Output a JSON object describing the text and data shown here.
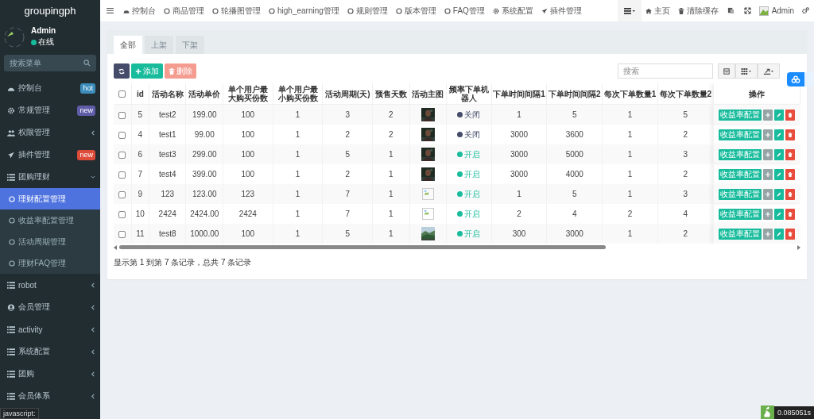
{
  "sidebar": {
    "brand": "groupingph",
    "user": {
      "name": "Admin",
      "status": "在线",
      "online": true
    },
    "search": {
      "placeholder": "搜索菜单"
    },
    "menu": [
      {
        "label": "控制台",
        "badge": {
          "text": "hot",
          "color": "#3c8dbc"
        }
      },
      {
        "label": "常规管理",
        "badge": {
          "text": "new",
          "color": "#605ca8"
        }
      },
      {
        "label": "权限管理",
        "expanded": false
      },
      {
        "label": "插件管理",
        "badge": {
          "text": "new",
          "color": "#dd4b39"
        }
      },
      {
        "label": "团购理财",
        "expanded": true,
        "children": [
          {
            "label": "理财配置管理",
            "selected": true
          },
          {
            "label": "收益率配置管理",
            "selected": false
          },
          {
            "label": "活动周期管理",
            "selected": false
          },
          {
            "label": "理财FAQ管理",
            "selected": false
          }
        ]
      },
      {
        "label": "robot",
        "expanded": false
      },
      {
        "label": "会员管理",
        "expanded": false
      },
      {
        "label": "activity",
        "expanded": false
      },
      {
        "label": "系统配置",
        "expanded": false
      },
      {
        "label": "团购",
        "expanded": false
      },
      {
        "label": "会员体系",
        "expanded": false
      }
    ]
  },
  "topnav": {
    "items": [
      "控制台",
      "商品管理",
      "轮播图管理",
      "high_earning管理",
      "规则管理",
      "版本管理",
      "FAQ管理",
      "系统配置",
      "插件管理"
    ],
    "tools": [
      "主页",
      "清除缓存"
    ],
    "user": "Admin"
  },
  "tabs": [
    {
      "label": "全部",
      "selected": true
    },
    {
      "label": "上架",
      "selected": false
    },
    {
      "label": "下架",
      "selected": false
    }
  ],
  "toolbar": {
    "add": "添加",
    "delete": {
      "label": "删除",
      "disabled": true
    },
    "search": {
      "placeholder": "搜索"
    }
  },
  "table": {
    "select_all_checked": false,
    "columns": [
      "id",
      "活动名称",
      "活动单价",
      "单个用户最大购买份数",
      "单个用户最小购买份数",
      "活动周期(天)",
      "预售天数",
      "活动主图",
      "频率下单机器人",
      "下单时间间隔1",
      "下单时间间隔2",
      "每次下单数量1",
      "每次下单数量2",
      "操作"
    ],
    "rows": [
      {
        "checked": false,
        "cells": [
          "5",
          "test2",
          "199.00",
          "100",
          "1",
          "3",
          "2"
        ],
        "robot": {
          "on": false,
          "label": "关闭"
        },
        "more": [
          "1",
          "5",
          "1",
          "5"
        ],
        "action": "收益率配置"
      },
      {
        "checked": false,
        "cells": [
          "4",
          "test1",
          "99.00",
          "100",
          "1",
          "2",
          "2"
        ],
        "robot": {
          "on": false,
          "label": "关闭"
        },
        "more": [
          "3000",
          "3600",
          "1",
          "2"
        ],
        "action": "收益率配置"
      },
      {
        "checked": false,
        "cells": [
          "6",
          "test3",
          "299.00",
          "100",
          "1",
          "5",
          "1"
        ],
        "robot": {
          "on": true,
          "label": "开启"
        },
        "more": [
          "3000",
          "5000",
          "1",
          "3"
        ],
        "action": "收益率配置"
      },
      {
        "checked": false,
        "cells": [
          "7",
          "test4",
          "399.00",
          "100",
          "1",
          "2",
          "1"
        ],
        "robot": {
          "on": true,
          "label": "开启"
        },
        "more": [
          "3000",
          "4000",
          "1",
          "2"
        ],
        "action": "收益率配置"
      },
      {
        "checked": false,
        "cells": [
          "9",
          "123",
          "123.00",
          "123",
          "1",
          "7",
          "1"
        ],
        "thumbnail": {
          "kind": "broken"
        },
        "robot": {
          "on": true,
          "label": "开启"
        },
        "more": [
          "1",
          "5",
          "1",
          "3"
        ],
        "action": "收益率配置"
      },
      {
        "checked": false,
        "cells": [
          "10",
          "2424",
          "2424.00",
          "2424",
          "1",
          "7",
          "1"
        ],
        "thumbnail": {
          "kind": "broken"
        },
        "robot": {
          "on": true,
          "label": "开启"
        },
        "more": [
          "2",
          "4",
          "2",
          "4"
        ],
        "action": "收益率配置"
      },
      {
        "checked": false,
        "cells": [
          "11",
          "test8",
          "1000.00",
          "100",
          "1",
          "5",
          "1"
        ],
        "thumbnail": {
          "kind": "landscape"
        },
        "robot": {
          "on": true,
          "label": "开启"
        },
        "more": [
          "300",
          "3000",
          "1",
          "2"
        ],
        "action": "收益率配置"
      }
    ]
  },
  "footer": "显示第 1 到第 7 条记录，总共 7 条记录",
  "status_tip": "javascript:",
  "timer": "0.085051s"
}
